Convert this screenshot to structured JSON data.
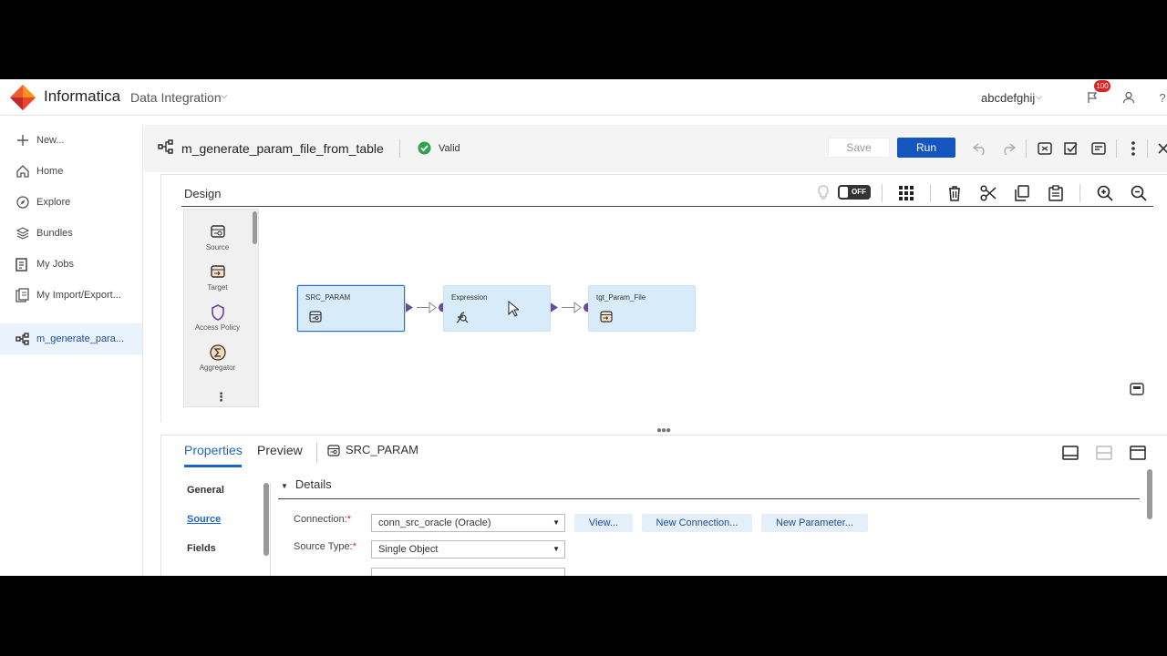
{
  "header": {
    "brand": "Informatica",
    "product": "Data Integration",
    "org": "abcdefghij",
    "notification_count": "100"
  },
  "sidebar": {
    "items": [
      {
        "label": "New...",
        "icon": "plus-icon"
      },
      {
        "label": "Home",
        "icon": "home-icon"
      },
      {
        "label": "Explore",
        "icon": "compass-icon"
      },
      {
        "label": "Bundles",
        "icon": "layers-icon"
      },
      {
        "label": "My Jobs",
        "icon": "jobs-icon"
      },
      {
        "label": "My Import/Export...",
        "icon": "import-export-icon"
      }
    ],
    "open_asset": {
      "label": "m_generate_para...",
      "icon": "mapping-icon"
    }
  },
  "titlebar": {
    "mapping_name": "m_generate_param_file_from_table",
    "status": "Valid",
    "save_label": "Save",
    "run_label": "Run"
  },
  "design": {
    "title": "Design",
    "toggle_label": "OFF",
    "palette": [
      {
        "label": "Source",
        "icon": "source-icon"
      },
      {
        "label": "Target",
        "icon": "target-icon"
      },
      {
        "label": "Access Policy",
        "icon": "shield-icon"
      },
      {
        "label": "Aggregator",
        "icon": "sigma-icon"
      }
    ],
    "nodes": [
      {
        "label": "SRC_PARAM",
        "icon": "source-icon"
      },
      {
        "label": "Expression",
        "icon": "expression-icon"
      },
      {
        "label": "tgt_Param_File",
        "icon": "target-icon"
      }
    ]
  },
  "properties": {
    "tabs": [
      "Properties",
      "Preview"
    ],
    "selected_object": "SRC_PARAM",
    "nav": [
      "General",
      "Source",
      "Fields"
    ],
    "section": "Details",
    "connection": {
      "label": "Connection:",
      "value": "conn_src_oracle (Oracle)"
    },
    "source_type": {
      "label": "Source Type:",
      "value": "Single Object"
    },
    "buttons": {
      "view": "View...",
      "new_connection": "New Connection...",
      "new_parameter": "New Parameter..."
    }
  },
  "colors": {
    "accent": "#1456bf",
    "valid": "#2ea44f",
    "node_fill": "#d8ebf8",
    "port": "#6b4c9a"
  }
}
